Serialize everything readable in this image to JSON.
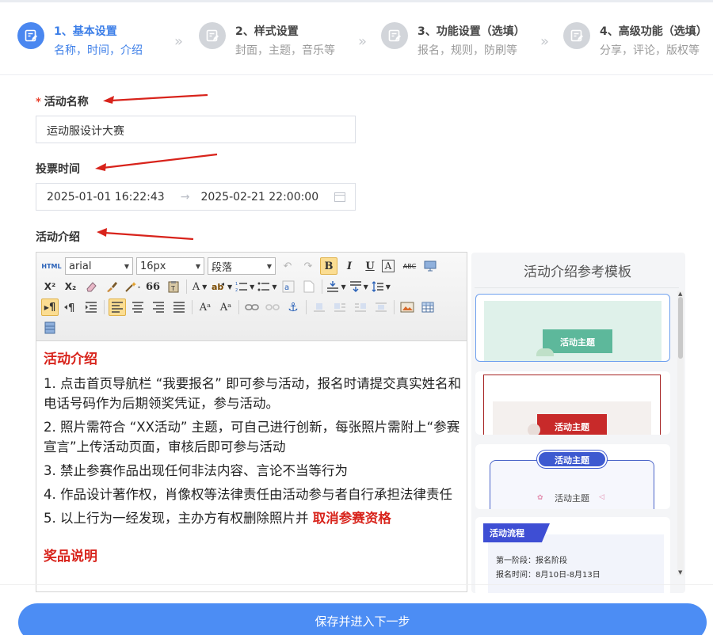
{
  "steps": [
    {
      "title": "1、基本设置",
      "sub": "名称，时间，介绍",
      "active": true
    },
    {
      "title": "2、样式设置",
      "sub": "封面，主题，音乐等",
      "active": false
    },
    {
      "title": "3、功能设置（选填）",
      "sub": "报名，规则，防刷等",
      "active": false
    },
    {
      "title": "4、高级功能（选填）",
      "sub": "分享，评论，版权等",
      "active": false
    }
  ],
  "form": {
    "name_label": "活动名称",
    "name_required": "*",
    "name_value": "运动服设计大赛",
    "time_label": "投票时间",
    "time_start": "2025-01-01 16:22:43",
    "time_sep": "→",
    "time_end": "2025-02-21 22:00:00",
    "intro_label": "活动介绍"
  },
  "toolbar": {
    "html": "HTML",
    "font_family": "arial",
    "font_size": "16px",
    "paragraph": "段落",
    "bold": "B",
    "italic": "I",
    "underline": "U",
    "font_border": "A",
    "strike": "ABC",
    "sup": "X²",
    "sub": "X₂",
    "quote": "66",
    "font_color": "A",
    "indent_marker": "¶",
    "font_grow": "Aᵃ",
    "font_shrink": "Aᵃ"
  },
  "content": {
    "heading": "活动介绍",
    "items": [
      "1. 点击首页导航栏 “我要报名” 即可参与活动，报名时请提交真实姓名和电话号码作为后期领奖凭证，参与活动。",
      "2. 照片需符合 “XX活动” 主题，可自己进行创新，每张照片需附上“参赛宣言”上传活动页面，审核后即可参与活动",
      "3. 禁止参赛作品出现任何非法内容、言论不当等行为",
      "4. 作品设计著作权，肖像权等法律责任由活动参与者自行承担法律责任"
    ],
    "item5_prefix": "5. 以上行为一经发现，主办方有权删除照片并 ",
    "item5_emphasis": "取消参赛资格",
    "next_heading": "奖品说明"
  },
  "templates": {
    "title": "活动介绍参考模板",
    "cards": [
      {
        "theme_label": "活动主题"
      },
      {
        "theme_label": "活动主题"
      },
      {
        "theme_label": "活动主题",
        "inner_label": "活动主题"
      },
      {
        "tag": "活动流程",
        "line1": "第一阶段：报名阶段",
        "line2": "报名时间：8月10日-8月13日"
      }
    ]
  },
  "footer": {
    "save_label": "保存并进入下一步"
  },
  "colors": {
    "primary": "#4c8df4",
    "required": "#e8412d",
    "emphasis": "#d8231b"
  }
}
